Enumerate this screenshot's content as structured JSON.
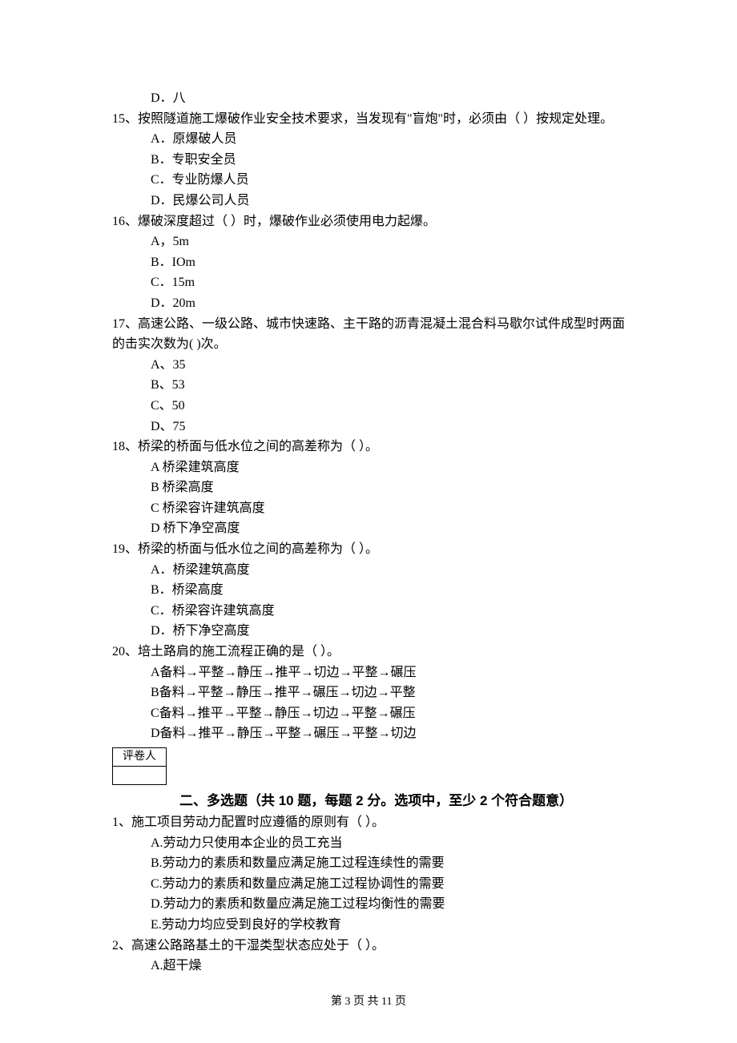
{
  "q14_last_option": {
    "label": "D．",
    "text": "八"
  },
  "q15": {
    "stem": "15、按照隧道施工爆破作业安全技术要求，当发现有\"盲炮\"时，必须由（    ）按规定处理。",
    "A": "A．原爆破人员",
    "B": "B．专职安全员",
    "C": "C．专业防爆人员",
    "D": "D．民爆公司人员"
  },
  "q16": {
    "stem": "16、爆破深度超过（    ）时，爆破作业必须使用电力起爆。",
    "A": "A，5m",
    "B": "B．IOm",
    "C": "C．15m",
    "D": "D．20m"
  },
  "q17": {
    "stem": "17、高速公路、一级公路、城市快速路、主干路的沥青混凝土混合料马歇尔试件成型时两面的击实次数为(    )次。",
    "A": "A、35",
    "B": "B、53",
    "C": "C、50",
    "D": "D、75"
  },
  "q18": {
    "stem": "18、桥梁的桥面与低水位之间的高差称为（    ）。",
    "A": "A 桥梁建筑高度",
    "B": "B 桥梁高度",
    "C": "C 桥梁容许建筑高度",
    "D": "D 桥下净空高度"
  },
  "q19": {
    "stem": "19、桥梁的桥面与低水位之间的高差称为（    ）。",
    "A": "A．桥梁建筑高度",
    "B": "B．桥梁高度",
    "C": "C．桥梁容许建筑高度",
    "D": "D．桥下净空高度"
  },
  "q20": {
    "stem": "20、培土路肩的施工流程正确的是（    ）。",
    "A": "A备料→平整→静压→推平→切边→平整→碾压",
    "B": "B备料→平整→静压→推平→碾压→切边→平整",
    "C": "C备料→推平→平整→静压→切边→平整→碾压",
    "D": "D备料→推平→静压→平整→碾压→平整→切边"
  },
  "grader_label": "评卷人",
  "section2_title": "二、多选题（共 10 题，每题 2 分。选项中，至少 2 个符合题意）",
  "mq1": {
    "stem": "1、施工项目劳动力配置时应遵循的原则有（    ）。",
    "A": "A.劳动力只使用本企业的员工充当",
    "B": "B.劳动力的素质和数量应满足施工过程连续性的需要",
    "C": "C.劳动力的素质和数量应满足施工过程协调性的需要",
    "D": "D.劳动力的素质和数量应满足施工过程均衡性的需要",
    "E": "E.劳动力均应受到良好的学校教育"
  },
  "mq2": {
    "stem": "2、高速公路路基土的干湿类型状态应处于（    ）。",
    "A": "A.超干燥"
  },
  "footer": "第 3 页 共 11 页"
}
